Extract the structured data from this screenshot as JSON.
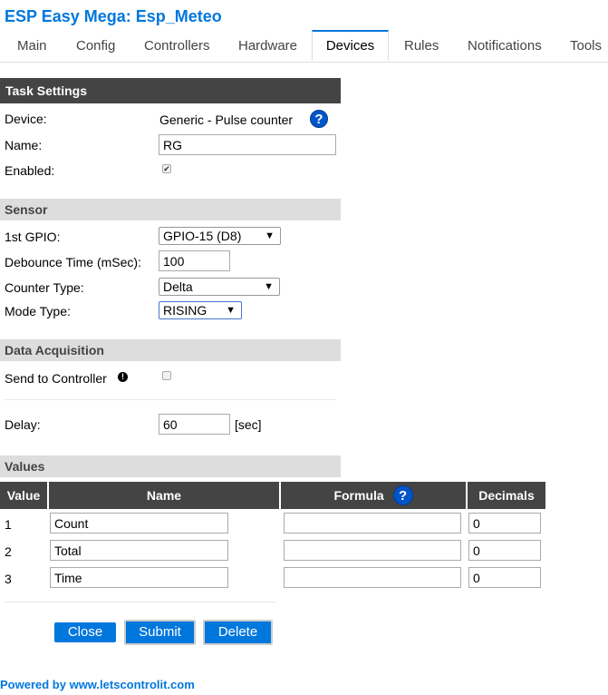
{
  "header": {
    "title": "ESP Easy Mega: Esp_Meteo"
  },
  "tabs": [
    {
      "label": "Main"
    },
    {
      "label": "Config"
    },
    {
      "label": "Controllers"
    },
    {
      "label": "Hardware"
    },
    {
      "label": "Devices"
    },
    {
      "label": "Rules"
    },
    {
      "label": "Notifications"
    },
    {
      "label": "Tools"
    }
  ],
  "active_tab": "Devices",
  "task": {
    "heading": "Task Settings",
    "device_label": "Device:",
    "device_value": "Generic - Pulse counter",
    "name_label": "Name:",
    "name_value": "RG",
    "enabled_label": "Enabled:",
    "enabled_checked": true
  },
  "sensor": {
    "heading": "Sensor",
    "gpio_label": "1st GPIO:",
    "gpio_value": "GPIO-15 (D8)",
    "debounce_label": "Debounce Time (mSec):",
    "debounce_value": "100",
    "counter_label": "Counter Type:",
    "counter_value": "Delta",
    "mode_label": "Mode Type:",
    "mode_value": "RISING"
  },
  "acquisition": {
    "heading": "Data Acquisition",
    "send_label": "Send to Controller",
    "send_checked": false,
    "delay_label": "Delay:",
    "delay_value": "60",
    "delay_unit": "[sec]"
  },
  "values": {
    "heading": "Values",
    "columns": [
      "Value",
      "Name",
      "Formula",
      "Decimals"
    ],
    "rows": [
      {
        "index": "1",
        "name": "Count",
        "formula": "",
        "decimals": "0"
      },
      {
        "index": "2",
        "name": "Total",
        "formula": "",
        "decimals": "0"
      },
      {
        "index": "3",
        "name": "Time",
        "formula": "",
        "decimals": "0"
      }
    ]
  },
  "buttons": {
    "close": "Close",
    "submit": "Submit",
    "delete": "Delete"
  },
  "footer": {
    "text": "Powered by www.letscontrolit.com"
  },
  "icons": {
    "help": "help-circle-icon",
    "info": "info-circle-icon",
    "dropdown": "triangle-down-icon"
  },
  "colors": {
    "accent": "#0077dd",
    "header_dark": "#444444",
    "header_light": "#dddddd"
  }
}
